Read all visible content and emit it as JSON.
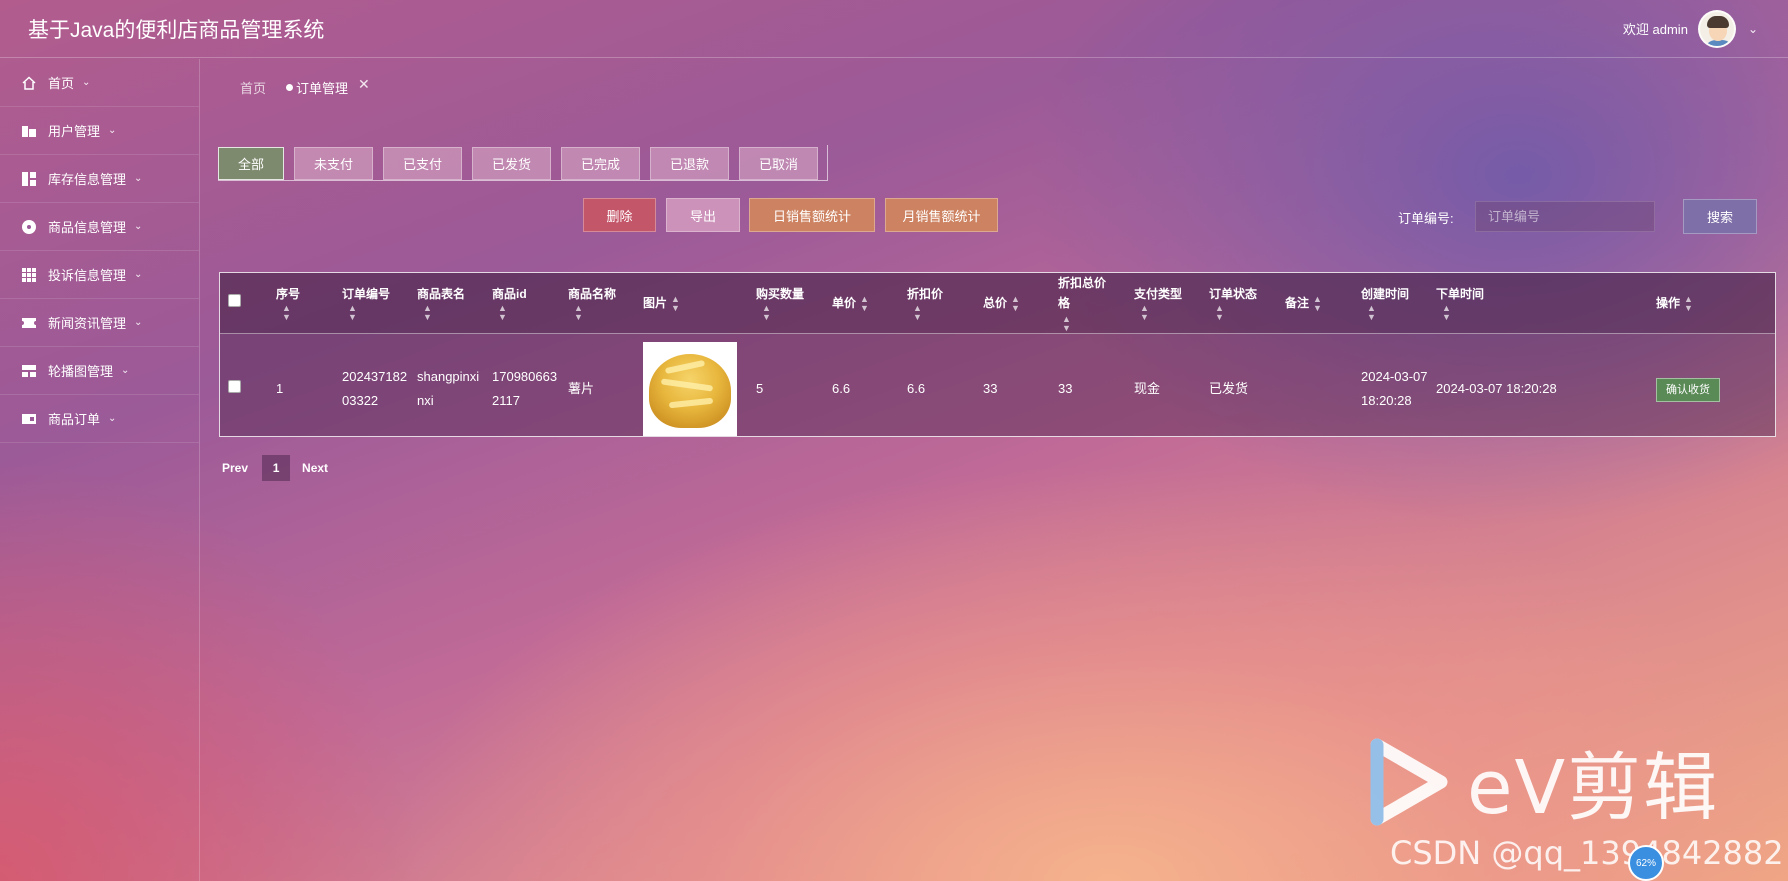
{
  "header": {
    "title": "基于Java的便利店商品管理系统",
    "welcome": "欢迎 admin"
  },
  "sidebar": {
    "items": [
      {
        "label": "首页",
        "icon": "home-icon"
      },
      {
        "label": "用户管理",
        "icon": "users-icon"
      },
      {
        "label": "库存信息管理",
        "icon": "grid-layout-icon"
      },
      {
        "label": "商品信息管理",
        "icon": "disc-icon"
      },
      {
        "label": "投诉信息管理",
        "icon": "apps-icon"
      },
      {
        "label": "新闻资讯管理",
        "icon": "ticket-icon"
      },
      {
        "label": "轮播图管理",
        "icon": "slides-icon"
      },
      {
        "label": "商品订单",
        "icon": "card-icon"
      }
    ]
  },
  "breadcrumb": {
    "home": "首页",
    "current": "订单管理",
    "close": "✕"
  },
  "tabs": [
    "全部",
    "未支付",
    "已支付",
    "已发货",
    "已完成",
    "已退款",
    "已取消"
  ],
  "actions": {
    "delete": "删除",
    "export": "导出",
    "daily": "日销售额统计",
    "monthly": "月销售额统计"
  },
  "search": {
    "label": "订单编号:",
    "placeholder": "订单编号",
    "button": "搜索"
  },
  "table": {
    "headers": {
      "index": "序号",
      "order_no": "订单编号",
      "table_name": "商品表名",
      "product_id": "商品id",
      "product_name": "商品名称",
      "image": "图片",
      "qty": "购买数量",
      "price": "单价",
      "discount_price": "折扣价",
      "total": "总价",
      "discount_total": "折扣总价格",
      "pay_type": "支付类型",
      "status": "订单状态",
      "remark": "备注",
      "created": "创建时间",
      "ordered": "下单时间",
      "ops": "操作"
    },
    "rows": [
      {
        "index": "1",
        "order_no": "20243718203322",
        "table_name": "shangpinxinxi",
        "product_id": "1709806632117",
        "product_name": "薯片",
        "qty": "5",
        "price": "6.6",
        "discount_price": "6.6",
        "total": "33",
        "discount_total": "33",
        "pay_type": "现金",
        "status": "已发货",
        "remark": "",
        "created": "2024-03-07 18:20:28",
        "ordered": "2024-03-07 18:20:28",
        "op_label": "确认收货"
      }
    ]
  },
  "pagination": {
    "prev": "Prev",
    "page": "1",
    "next": "Next"
  },
  "watermark": {
    "ev": "eV剪辑",
    "csdn": "CSDN @qq_1394842882",
    "badge": "62%"
  }
}
